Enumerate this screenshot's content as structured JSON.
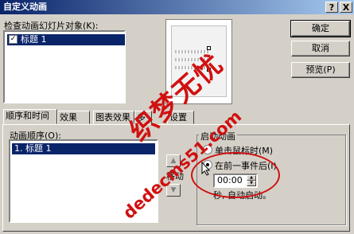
{
  "window": {
    "title": "自定义动画",
    "help_label": "?",
    "close_label": "X"
  },
  "objects_label": "检查动画幻灯片对象(K):",
  "objects_list": [
    {
      "label": "标题 1",
      "checked": true
    }
  ],
  "buttons": {
    "ok": "确定",
    "cancel": "取消",
    "preview": "预览(P)"
  },
  "tabs": [
    {
      "label": "顺序和时间",
      "active": true
    },
    {
      "label": "效果",
      "active": false
    },
    {
      "label": "图表效果",
      "active": false
    },
    {
      "label": "多",
      "active": false
    },
    {
      "label": "设置",
      "active": false
    }
  ],
  "sequence": {
    "label": "动画顺序(O):",
    "items": [
      "1. 标题 1"
    ],
    "move_label": "移动"
  },
  "start_animation": {
    "group_title": "启动动画",
    "option_mouse": "单击鼠标时(M)",
    "option_after": "在前一事件后(I)",
    "selected": "option_after",
    "time_value": "00:00",
    "auto_text": "秒, 自动启动。"
  },
  "watermark": {
    "chinese": "织梦无忧",
    "url": "dedecms51.com"
  },
  "colors": {
    "accent": "#0a246a",
    "watermark": "#d01010",
    "face": "#d4d0c8"
  }
}
